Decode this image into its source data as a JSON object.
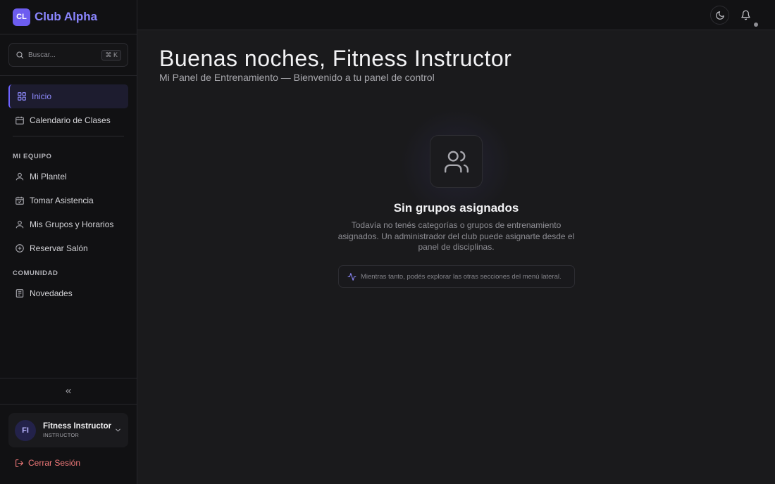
{
  "brand": {
    "badge": "CL",
    "name": "Club Alpha",
    "accent": "#6d5df0"
  },
  "search": {
    "placeholder": "Buscar...",
    "shortcut": "⌘ K"
  },
  "sidebar": {
    "primary": [
      {
        "label": "Inicio",
        "icon": "grid-icon",
        "active": true
      },
      {
        "label": "Calendario de Clases",
        "icon": "calendar-icon"
      }
    ],
    "sections": [
      {
        "title": "MI EQUIPO",
        "items": [
          {
            "label": "Mi Plantel",
            "icon": "user-icon"
          },
          {
            "label": "Tomar Asistencia",
            "icon": "calendar-check-icon"
          },
          {
            "label": "Mis Grupos y Horarios",
            "icon": "user-icon"
          },
          {
            "label": "Reservar Salón",
            "icon": "plus-circle-icon"
          }
        ]
      },
      {
        "title": "COMUNIDAD",
        "items": [
          {
            "label": "Novedades",
            "icon": "newspaper-icon"
          }
        ]
      }
    ]
  },
  "user": {
    "initials": "FI",
    "name": "Fitness Instructor",
    "role": "INSTRUCTOR"
  },
  "logout_label": "Cerrar Sesión",
  "main": {
    "greeting": "Buenas noches, Fitness Instructor",
    "subtitle": "Mi Panel de Entrenamiento — Bienvenido a tu panel de control",
    "empty_title": "Sin grupos asignados",
    "empty_desc": "Todavía no tenés categorías o grupos de entrenamiento asignados. Un administrador del club puede asignarte desde el panel de disciplinas.",
    "hint": "Mientras tanto, podés explorar las otras secciones del menú lateral."
  }
}
